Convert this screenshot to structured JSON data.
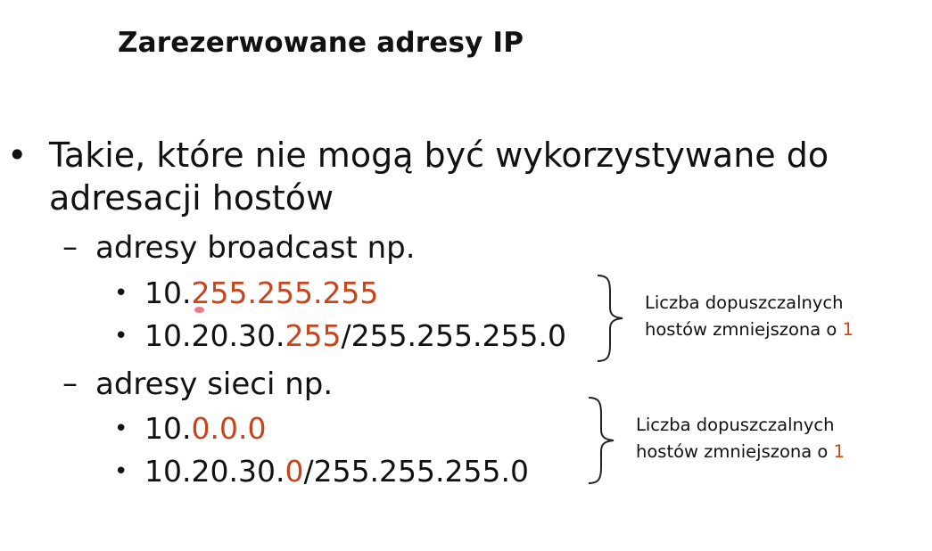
{
  "title": "Zarezerwowane adresy IP",
  "main_bullet": {
    "line1": "Takie, które nie mogą być wykorzystywane do",
    "line2": "adresacji hostów"
  },
  "broadcast": {
    "heading": "adresy broadcast np.",
    "example1": {
      "prefix": "10.",
      "highlight": "255.255.255"
    },
    "example2": {
      "prefix": "10.20.30.",
      "highlight": "255",
      "suffix": "/255.255.255.0"
    },
    "note_line1": "Liczba dopuszczalnych",
    "note_line2": "hostów zmniejszona o ",
    "note_value": "1"
  },
  "network": {
    "heading": "adresy sieci np.",
    "example1": {
      "prefix": "10.",
      "highlight": "0.0.0"
    },
    "example2": {
      "prefix": "10.20.30.",
      "highlight": "0",
      "suffix": "/255.255.255.0"
    },
    "note_line1": "Liczba dopuszczalnych",
    "note_line2": "hostów zmniejszona o ",
    "note_value": "1"
  },
  "colors": {
    "highlight": "#c8441a",
    "text": "#111111",
    "background": "#ffffff"
  },
  "icons": {
    "bullet": "bullet-dot",
    "dash": "en-dash",
    "brace": "right-curly-brace"
  }
}
